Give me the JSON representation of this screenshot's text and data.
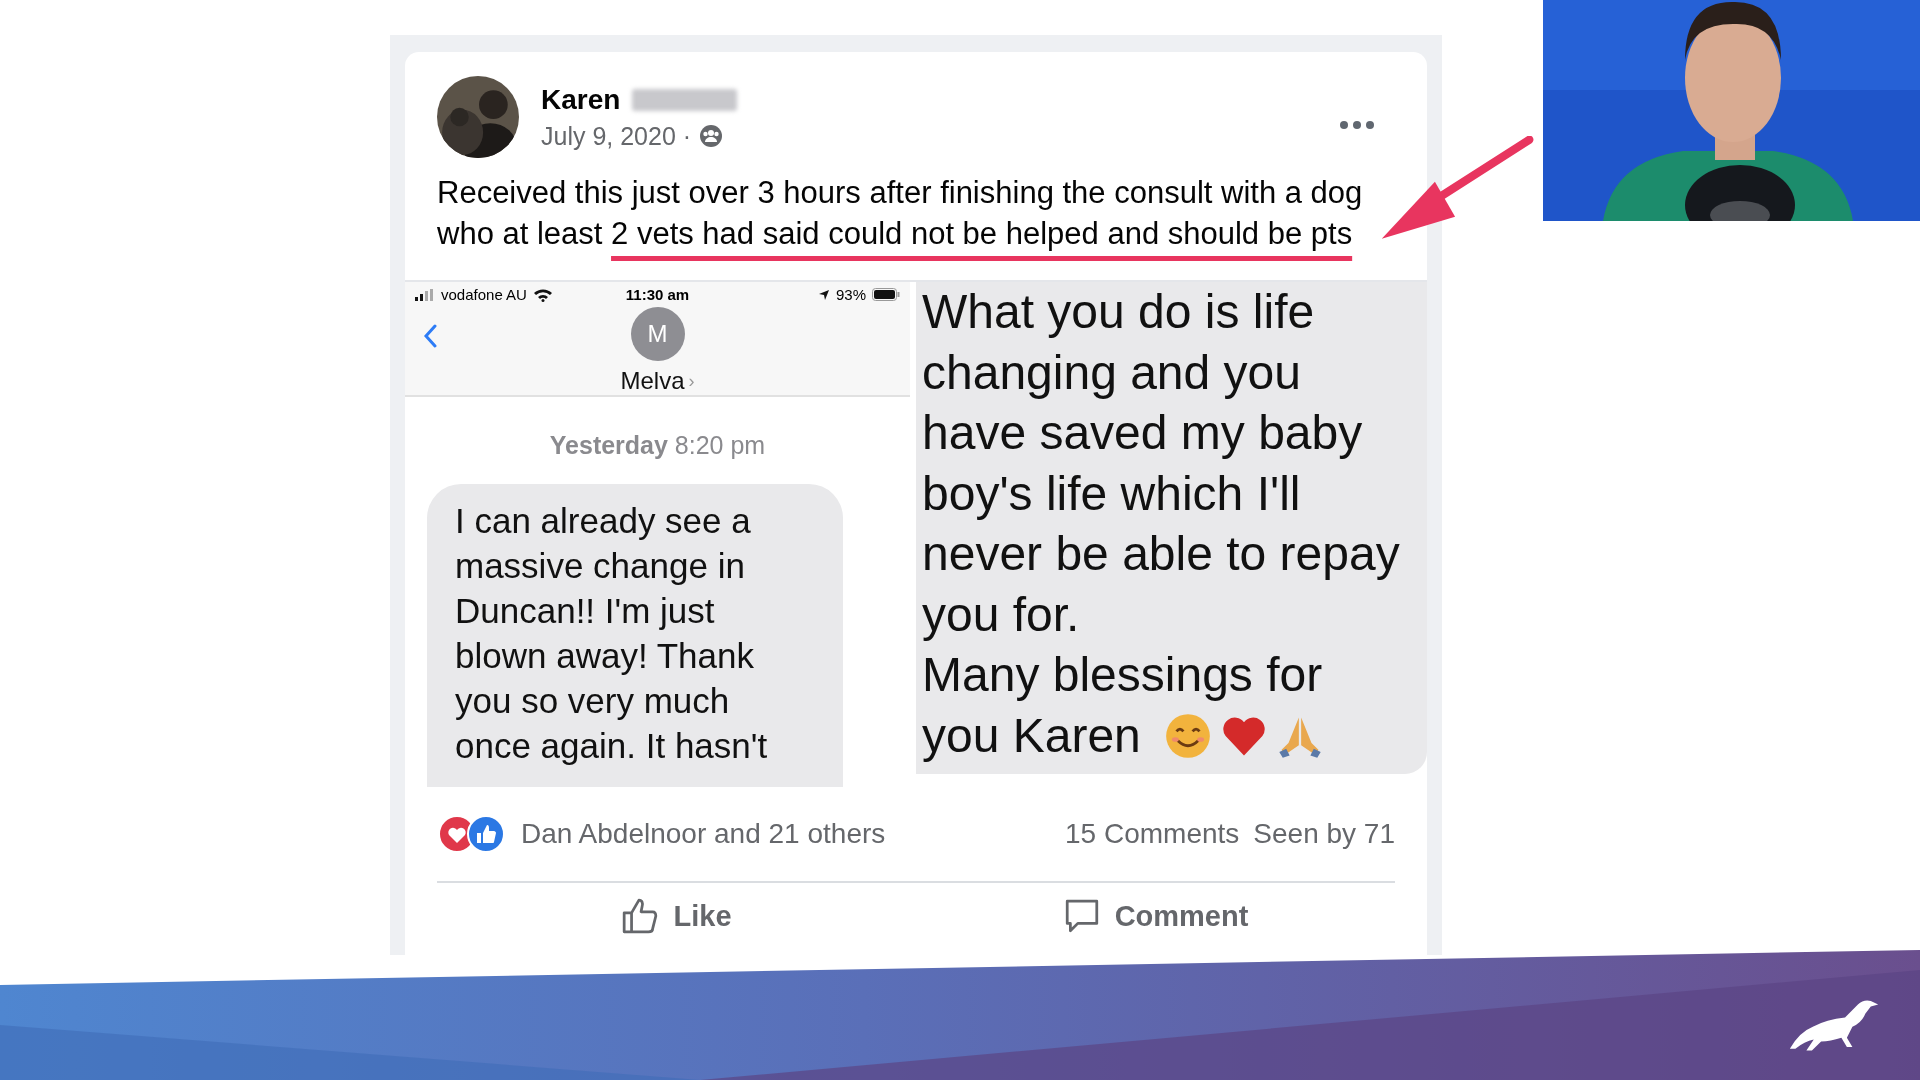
{
  "post": {
    "author": "Karen",
    "date": "July 9, 2020 ·",
    "text_lines": [
      {
        "text": "Received this just over 3 hours after finishing the consult with a dog"
      },
      {
        "text": "who at least ",
        "underlined": "2 vets had said could not be helped and should be pts"
      }
    ],
    "screenshot": {
      "status_bar": {
        "carrier": "vodafone AU",
        "time": "11:30 am",
        "battery": "93%"
      },
      "contact": {
        "initial": "M",
        "name": "Melva",
        "chevron": "›"
      },
      "timestamp": {
        "day": "Yesterday",
        "time": "8:20 pm"
      },
      "message_lines": [
        "I can already see a",
        "massive change in",
        "Duncan!! I'm just",
        "blown away! Thank",
        "you so very much",
        "once again. It hasn't"
      ],
      "reply_lines": [
        "What you do is life",
        "changing and you",
        "have saved my baby",
        "boy's life which I'll",
        "never be able to repay",
        "you for.",
        "Many blessings for"
      ],
      "reply_last_line": "you Karen"
    },
    "reactions": {
      "summary": "Dan Abdelnoor and 21 others",
      "comments": "15 Comments",
      "seen": "Seen by 71"
    },
    "actions": [
      {
        "kind": "like",
        "label": "Like"
      },
      {
        "kind": "comment",
        "label": "Comment"
      }
    ]
  }
}
